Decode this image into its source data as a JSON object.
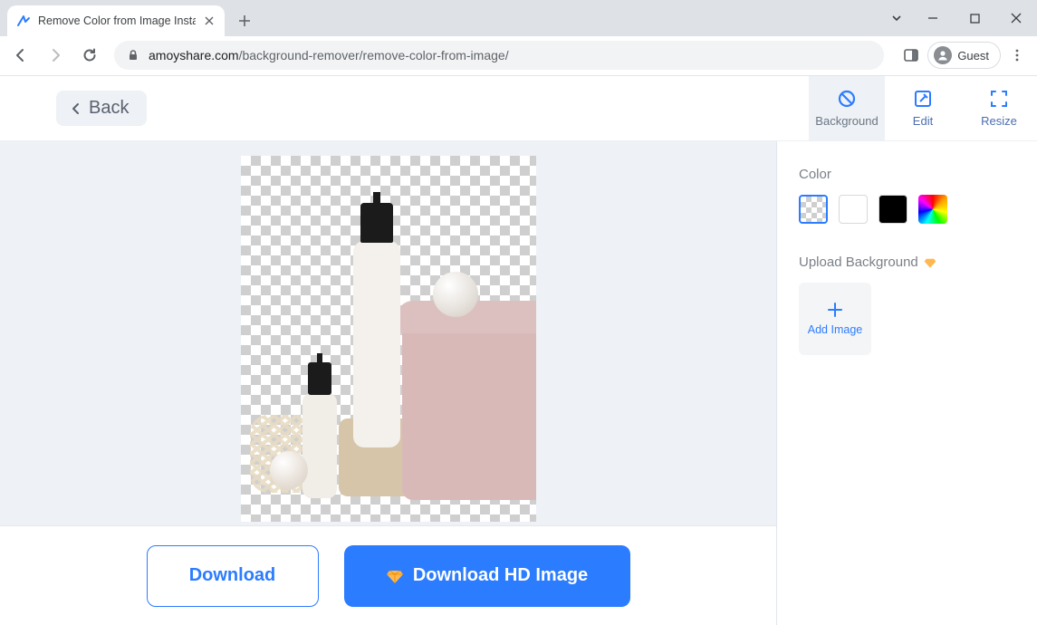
{
  "browser": {
    "tab_title": "Remove Color from Image Instan",
    "url_domain": "amoyshare.com",
    "url_path": "/background-remover/remove-color-from-image/",
    "guest_label": "Guest"
  },
  "toolbar": {
    "back_label": "Back",
    "tabs": [
      {
        "id": "background",
        "label": "Background",
        "active": true
      },
      {
        "id": "edit",
        "label": "Edit",
        "active": false
      },
      {
        "id": "resize",
        "label": "Resize",
        "active": false
      }
    ]
  },
  "side": {
    "color_label": "Color",
    "swatches": [
      "transparent",
      "white",
      "black",
      "rainbow"
    ],
    "selected_swatch": "transparent",
    "upload_label": "Upload Background",
    "add_image_label": "Add Image"
  },
  "buttons": {
    "download": "Download",
    "download_hd": "Download HD Image"
  },
  "colors": {
    "accent": "#2b7cff"
  }
}
